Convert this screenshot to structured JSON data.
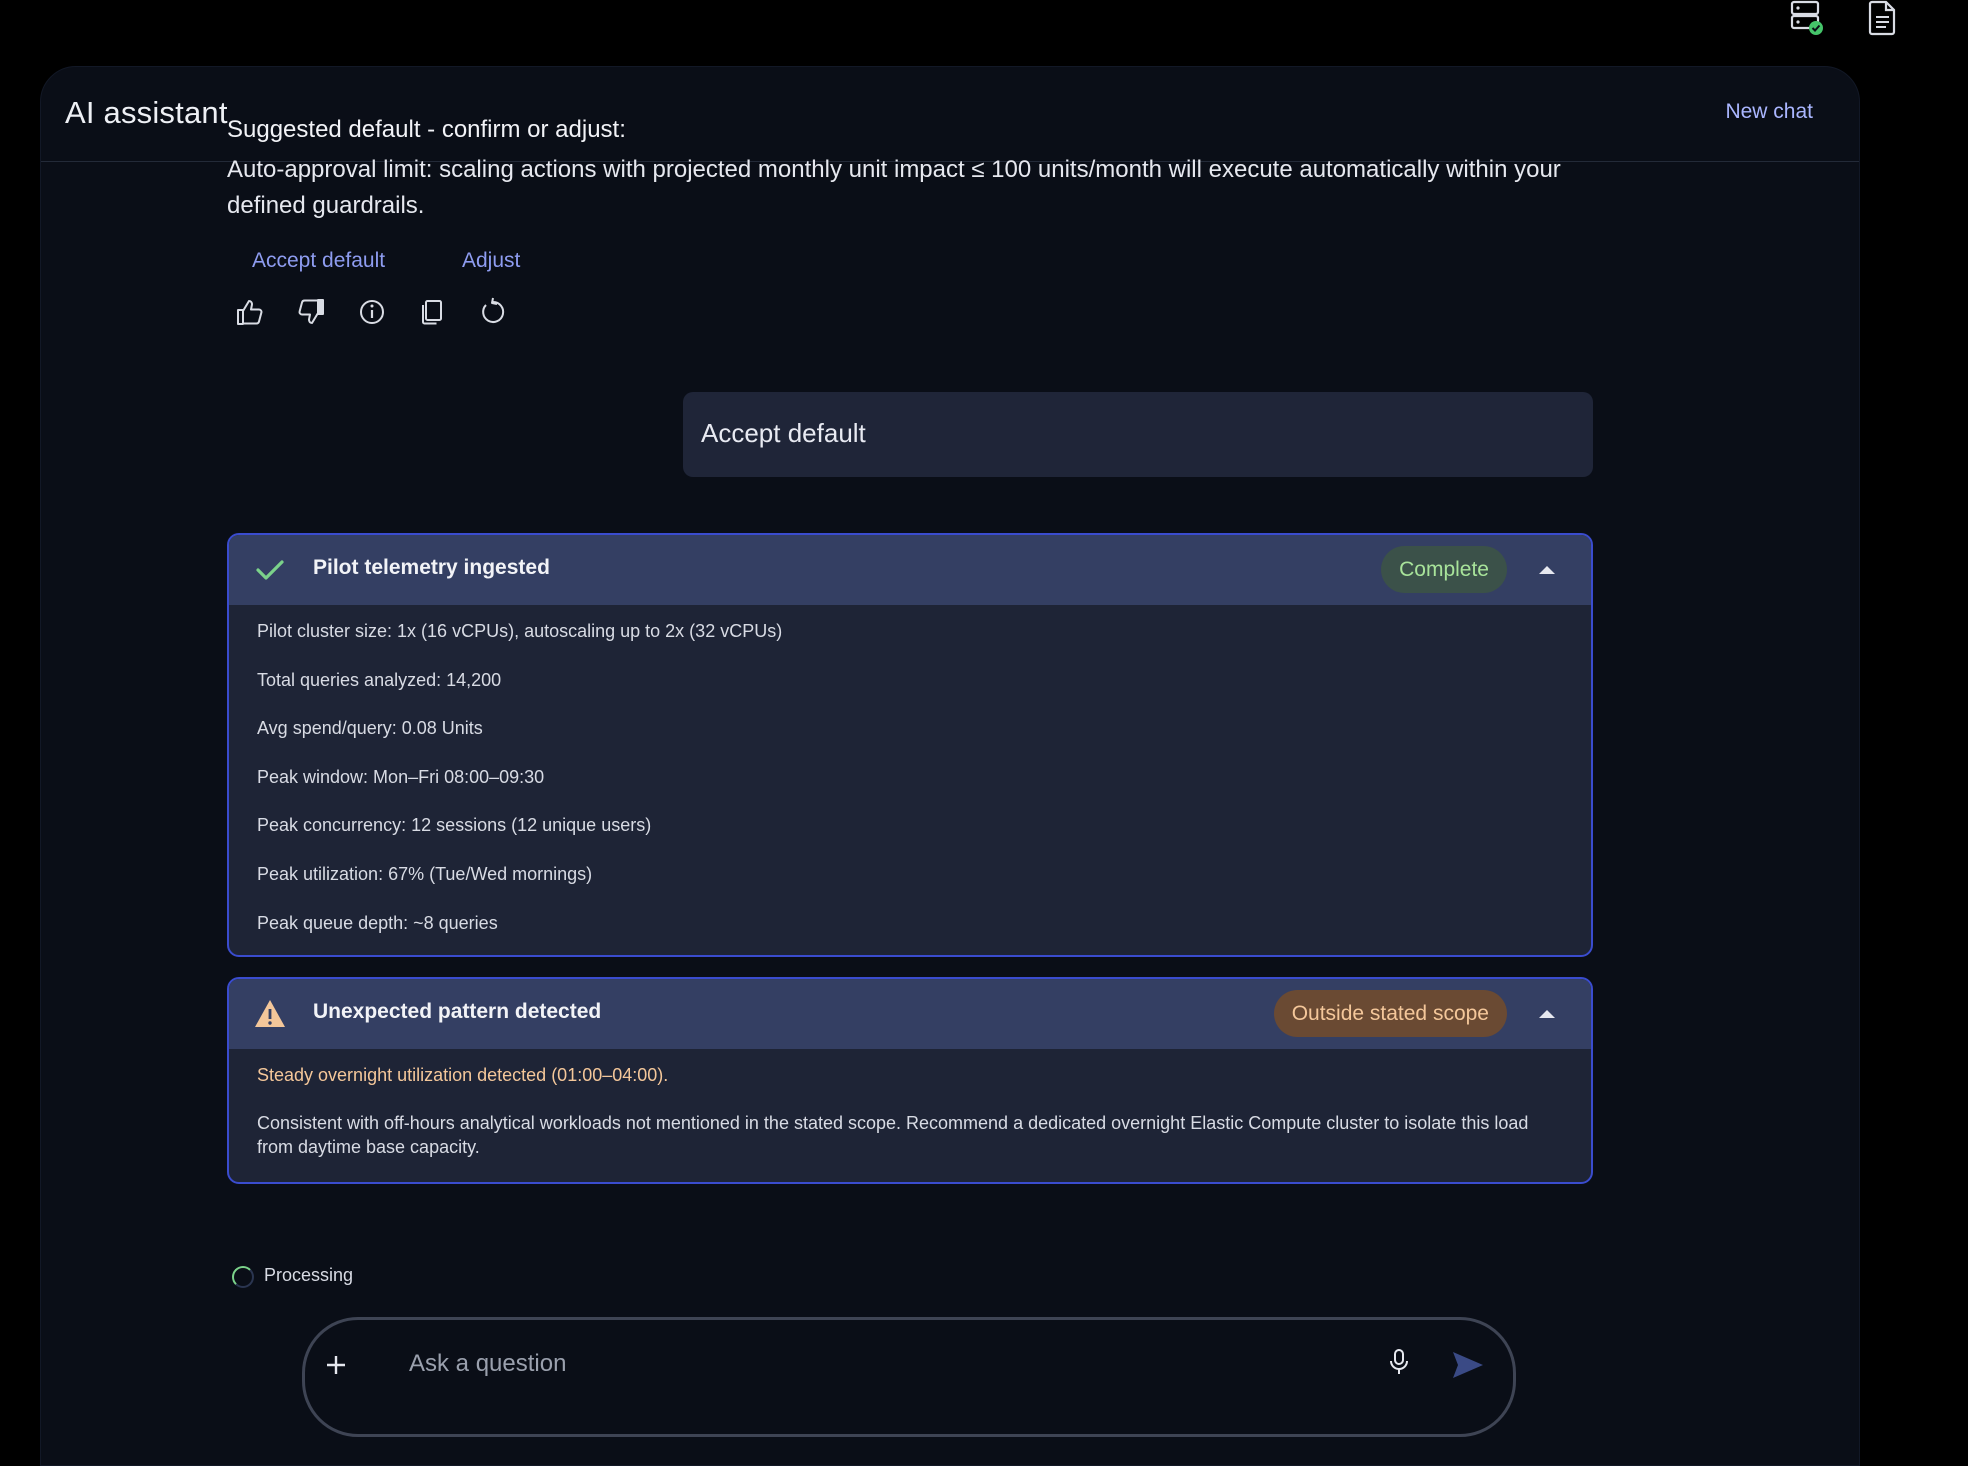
{
  "topbar": {
    "icons": [
      "server-status-icon",
      "document-icon"
    ]
  },
  "panel": {
    "title": "AI assistant",
    "new_chat_label": "New chat"
  },
  "assistant_message": {
    "heading": "Suggested default - confirm or adjust:",
    "body": "Auto-approval limit: scaling actions with projected monthly unit impact ≤ 100 units/month will execute automatically within your defined guardrails.",
    "actions": [
      "Accept default",
      "Adjust"
    ],
    "feedback_icons": [
      "thumbs-up-icon",
      "thumbs-down-icon",
      "info-icon",
      "copy-icon",
      "regenerate-icon"
    ]
  },
  "user_message": {
    "text": "Accept default"
  },
  "telemetry_card": {
    "title": "Pilot telemetry ingested",
    "status": "Complete",
    "status_color": "#a8e39a",
    "details": [
      "Pilot cluster size: 1x (16 vCPUs), autoscaling up to 2x (32 vCPUs)",
      "Total queries analyzed: 14,200",
      "Avg spend/query: 0.08 Units",
      "Peak window: Mon–Fri 08:00–09:30",
      "Peak concurrency: 12 sessions (12 unique users)",
      "Peak utilization: 67% (Tue/Wed mornings)",
      "Peak queue depth: ~8 queries"
    ]
  },
  "pattern_card": {
    "title": "Unexpected pattern detected",
    "status": "Outside stated scope",
    "status_color": "#f4c79a",
    "warning": "Steady overnight utilization detected (01:00–04:00).",
    "description": "Consistent with off-hours analytical workloads not mentioned in the stated scope. Recommend a dedicated overnight Elastic Compute cluster to isolate this load from daytime base capacity."
  },
  "processing": {
    "label": "Processing"
  },
  "composer": {
    "placeholder": "Ask a question"
  },
  "colors": {
    "accent_link": "#8e9cf0",
    "card_border": "#3a4ccf",
    "panel_bg": "#0a0e17"
  }
}
